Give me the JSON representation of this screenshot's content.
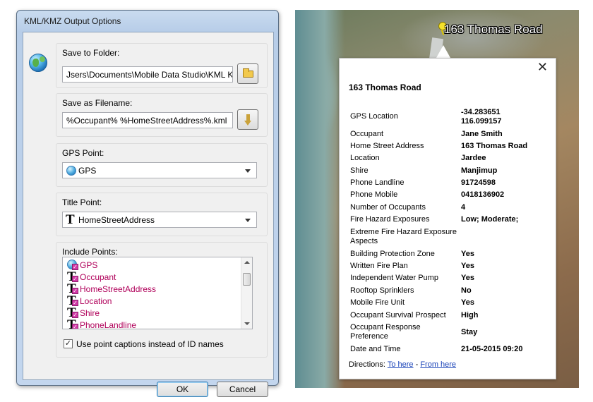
{
  "dialog": {
    "title": "KML/KMZ Output Options",
    "save_folder": {
      "label": "Save to Folder:",
      "value": "Jsers\\Documents\\Mobile Data Studio\\KML KMZ"
    },
    "save_filename": {
      "label": "Save as Filename:",
      "value": "%Occupant% %HomeStreetAddress%.kml"
    },
    "gps_point": {
      "label": "GPS Point:",
      "value": "GPS"
    },
    "title_point": {
      "label": "Title Point:",
      "value": "HomeStreetAddress"
    },
    "include_points": {
      "label": "Include Points:",
      "items": [
        "GPS",
        "Occupant",
        "HomeStreetAddress",
        "Location",
        "Shire",
        "PhoneLandline"
      ]
    },
    "use_captions_label": "Use point captions instead of ID names",
    "ok_label": "OK",
    "cancel_label": "Cancel"
  },
  "map": {
    "pin_label": "163 Thomas Road",
    "popup": {
      "close": "✕",
      "title": "163 Thomas Road",
      "rows": [
        {
          "k": "GPS Location",
          "v": "-34.283651",
          "v2": "116.099157"
        },
        {
          "k": "Occupant",
          "v": "Jane Smith"
        },
        {
          "k": "Home Street Address",
          "v": "163 Thomas Road"
        },
        {
          "k": "Location",
          "v": "Jardee"
        },
        {
          "k": "Shire",
          "v": "Manjimup"
        },
        {
          "k": "Phone Landline",
          "v": "91724598"
        },
        {
          "k": "Phone Mobile",
          "v": "0418136902"
        },
        {
          "k": "Number of Occupants",
          "v": "4"
        },
        {
          "k": "Fire Hazard Exposures",
          "v": "Low; Moderate;"
        },
        {
          "k": "Extreme Fire Hazard Exposure Aspects",
          "v": ""
        },
        {
          "k": "Building Protection Zone",
          "v": "Yes"
        },
        {
          "k": "Written Fire Plan",
          "v": "Yes"
        },
        {
          "k": "Independent Water Pump",
          "v": "Yes"
        },
        {
          "k": "Rooftop Sprinklers",
          "v": "No"
        },
        {
          "k": "Mobile Fire Unit",
          "v": "Yes"
        },
        {
          "k": "Occupant Survival Prospect",
          "v": "High"
        },
        {
          "k": "Occupant Response Preference",
          "v": "Stay"
        },
        {
          "k": "Date and Time",
          "v": "21-05-2015 09:20"
        }
      ],
      "directions_prefix": "Directions:",
      "to_here": "To here",
      "separator": " - ",
      "from_here": "From here"
    }
  }
}
